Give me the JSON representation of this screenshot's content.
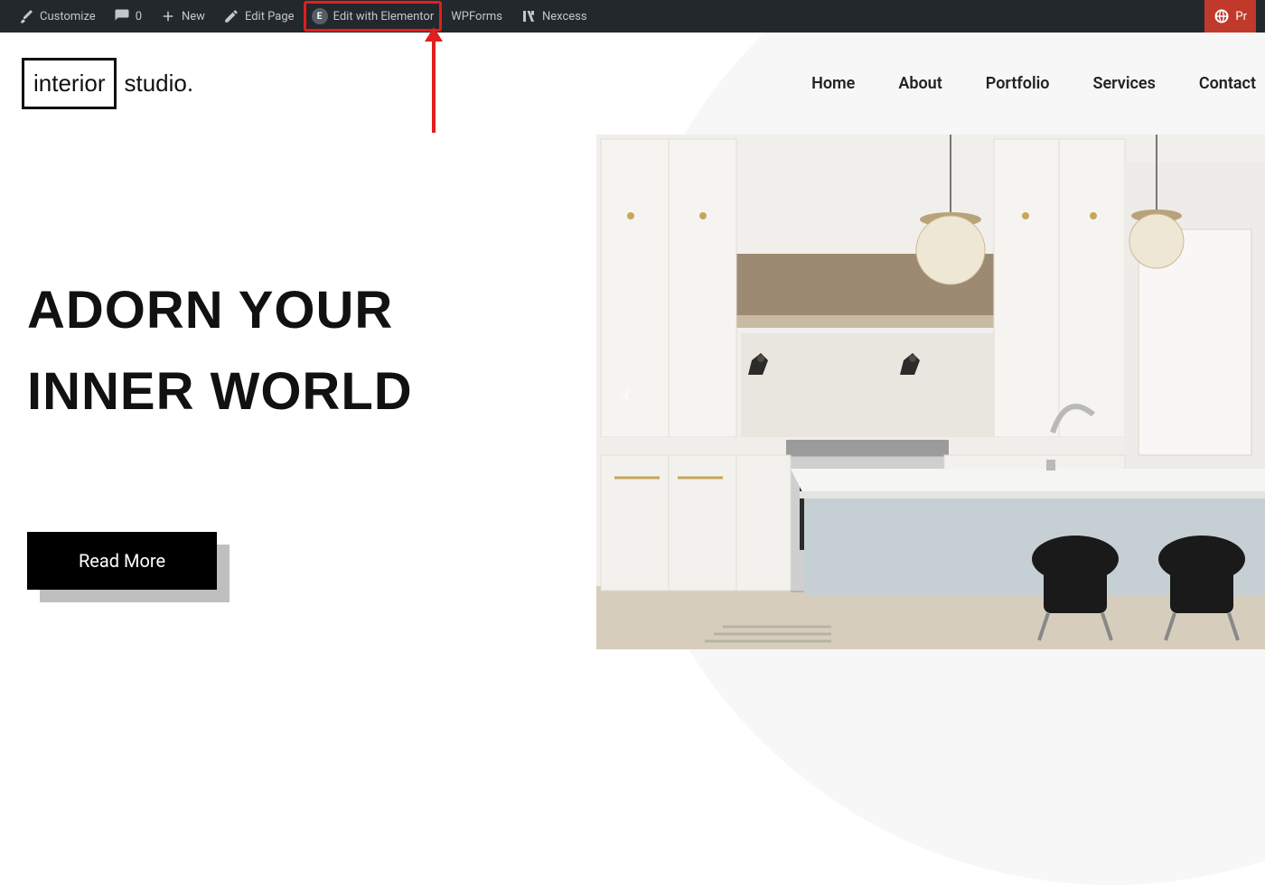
{
  "adminBar": {
    "customize": "Customize",
    "commentsCount": "0",
    "new": "New",
    "editPage": "Edit Page",
    "editElementor": "Edit with Elementor",
    "wpforms": "WPForms",
    "nexcess": "Nexcess",
    "rightLabel": "Pr",
    "elementorBadge": "E"
  },
  "logo": {
    "boxed": "interior",
    "after": "studio."
  },
  "nav": {
    "items": [
      {
        "label": "Home"
      },
      {
        "label": "About"
      },
      {
        "label": "Portfolio"
      },
      {
        "label": "Services"
      },
      {
        "label": "Contact"
      }
    ]
  },
  "hero": {
    "titleLine1": "ADORN YOUR",
    "titleLine2": "INNER WORLD",
    "cta": "Read More"
  },
  "annotation": {
    "highlighted": "edit-with-elementor"
  }
}
